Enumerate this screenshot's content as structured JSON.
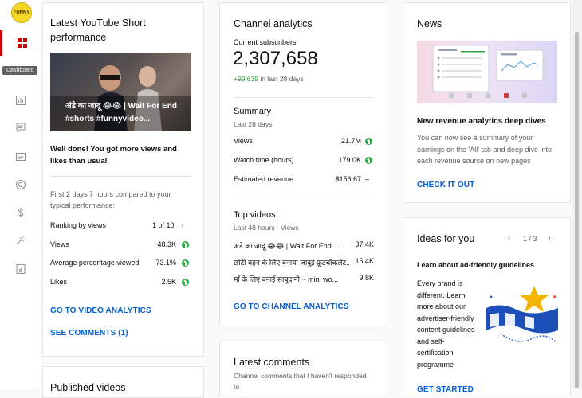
{
  "sidebar": {
    "tooltip": "Dashboard",
    "avatar_text": "FUNNY",
    "items": [
      "dashboard-icon",
      "analytics-icon",
      "comments-icon",
      "subtitles-icon",
      "copyright-icon",
      "earn-icon",
      "customization-icon",
      "audio-library-icon"
    ]
  },
  "short_card": {
    "title": "Latest YouTube Short performance",
    "thumb_caption": "अंडे का जादू 😂😂 | Wait For End #shorts #funnyvideo...",
    "message": "Well done! You got more views and likes than usual.",
    "compare_text": "First 2 days 7 hours compared to your typical performance:",
    "ranking_label": "Ranking by views",
    "ranking_value": "1 of 10",
    "metrics": [
      {
        "label": "Views",
        "value": "48.3K"
      },
      {
        "label": "Average percentage viewed",
        "value": "73.1%"
      },
      {
        "label": "Likes",
        "value": "2.5K"
      }
    ],
    "link_analytics": "GO TO VIDEO ANALYTICS",
    "link_comments": "SEE COMMENTS (1)"
  },
  "published_card": {
    "title": "Published videos"
  },
  "channel_card": {
    "title": "Channel analytics",
    "subs_label": "Current subscribers",
    "subs_value": "2,307,658",
    "subs_delta": "+99,639",
    "subs_delta_suffix": " in last 28 days",
    "summary_title": "Summary",
    "summary_sub": "Last 28 days",
    "summary": [
      {
        "label": "Views",
        "value": "21.7M"
      },
      {
        "label": "Watch time (hours)",
        "value": "179.0K"
      },
      {
        "label": "Estimated revenue",
        "value": "$156.67",
        "trend": "–"
      }
    ],
    "top_title": "Top videos",
    "top_sub": "Last 48 hours · Views",
    "top_videos": [
      {
        "title": "अंडे का जादू 😂😂 | Wait For End ...",
        "views": "37.4K"
      },
      {
        "title": "छोटी बहन के लिए बनाया जादुई फ्रूटचॉकलेट...",
        "views": "15.4K"
      },
      {
        "title": "माँ के लिए बनाई साबुदानी ~ mini wo...",
        "views": "9.8K"
      }
    ],
    "link": "GO TO CHANNEL ANALYTICS"
  },
  "comments_card": {
    "title": "Latest comments",
    "sub": "Channel comments that I haven't responded to"
  },
  "news_card": {
    "title": "News",
    "headline": "New revenue analytics deep dives",
    "body": "You can now see a summary of your earnings on the 'All' tab and deep dive into each revenue source on new pages",
    "link": "CHECK IT OUT"
  },
  "ideas_card": {
    "title": "Ideas for you",
    "pager": "1 / 3",
    "subtitle": "Learn about ad-friendly guidelines",
    "body": "Every brand is different. Learn more about our advertiser-friendly content guidelines and self-certification programme",
    "link": "GET STARTED"
  },
  "colors": {
    "accent": "#065fd4",
    "red": "#cc0000",
    "green": "#2ba640"
  }
}
